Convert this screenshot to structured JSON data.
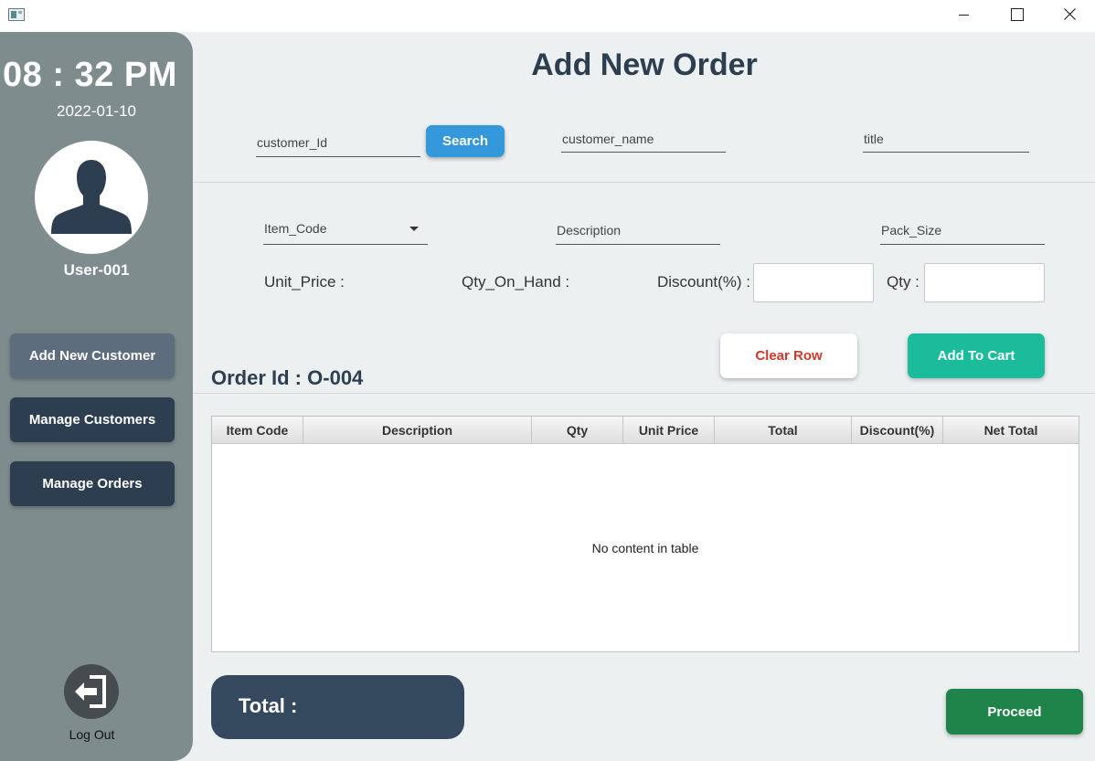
{
  "window": {
    "controls": [
      "minimize-icon",
      "maximize-icon",
      "close-icon"
    ]
  },
  "sidebar": {
    "time": "08 : 32 PM",
    "date": "2022-01-10",
    "user": "User-001",
    "buttons": [
      "Add New Customer",
      "Manage Customers",
      "Manage Orders"
    ],
    "logout_label": "Log Out"
  },
  "header": {
    "title": "Add New Order"
  },
  "customer": {
    "id_placeholder": "customer_Id",
    "search_label": "Search",
    "name_placeholder": "customer_name",
    "title_placeholder": "title"
  },
  "item": {
    "code_prompt": "Item_Code",
    "description_placeholder": "Description",
    "pack_size_placeholder": "Pack_Size",
    "unit_price_label": "Unit_Price :",
    "qty_on_hand_label": "Qty_On_Hand :",
    "discount_label": "Discount(%) :",
    "qty_label": "Qty :",
    "discount_value": "",
    "qty_value": ""
  },
  "actions": {
    "clear_row": "Clear Row",
    "add_to_cart": "Add To Cart"
  },
  "order": {
    "id_label": "Order Id :",
    "id_value": "O-004"
  },
  "table": {
    "columns": [
      "Item Code",
      "Description",
      "Qty",
      "Unit Price",
      "Total",
      "Discount(%)",
      "Net Total"
    ],
    "rows": [],
    "empty_text": "No content in table"
  },
  "footer": {
    "total_label": "Total :",
    "proceed_label": "Proceed"
  },
  "colors": {
    "sidebar": "#7f8c8d",
    "dark_button": "#2c3e50",
    "active_button": "#5d6d7e",
    "search_button": "#3498db",
    "add_to_cart": "#1abc9c",
    "clear_row_text": "#d0392b",
    "proceed": "#1e8449",
    "total_box": "#34495e"
  }
}
